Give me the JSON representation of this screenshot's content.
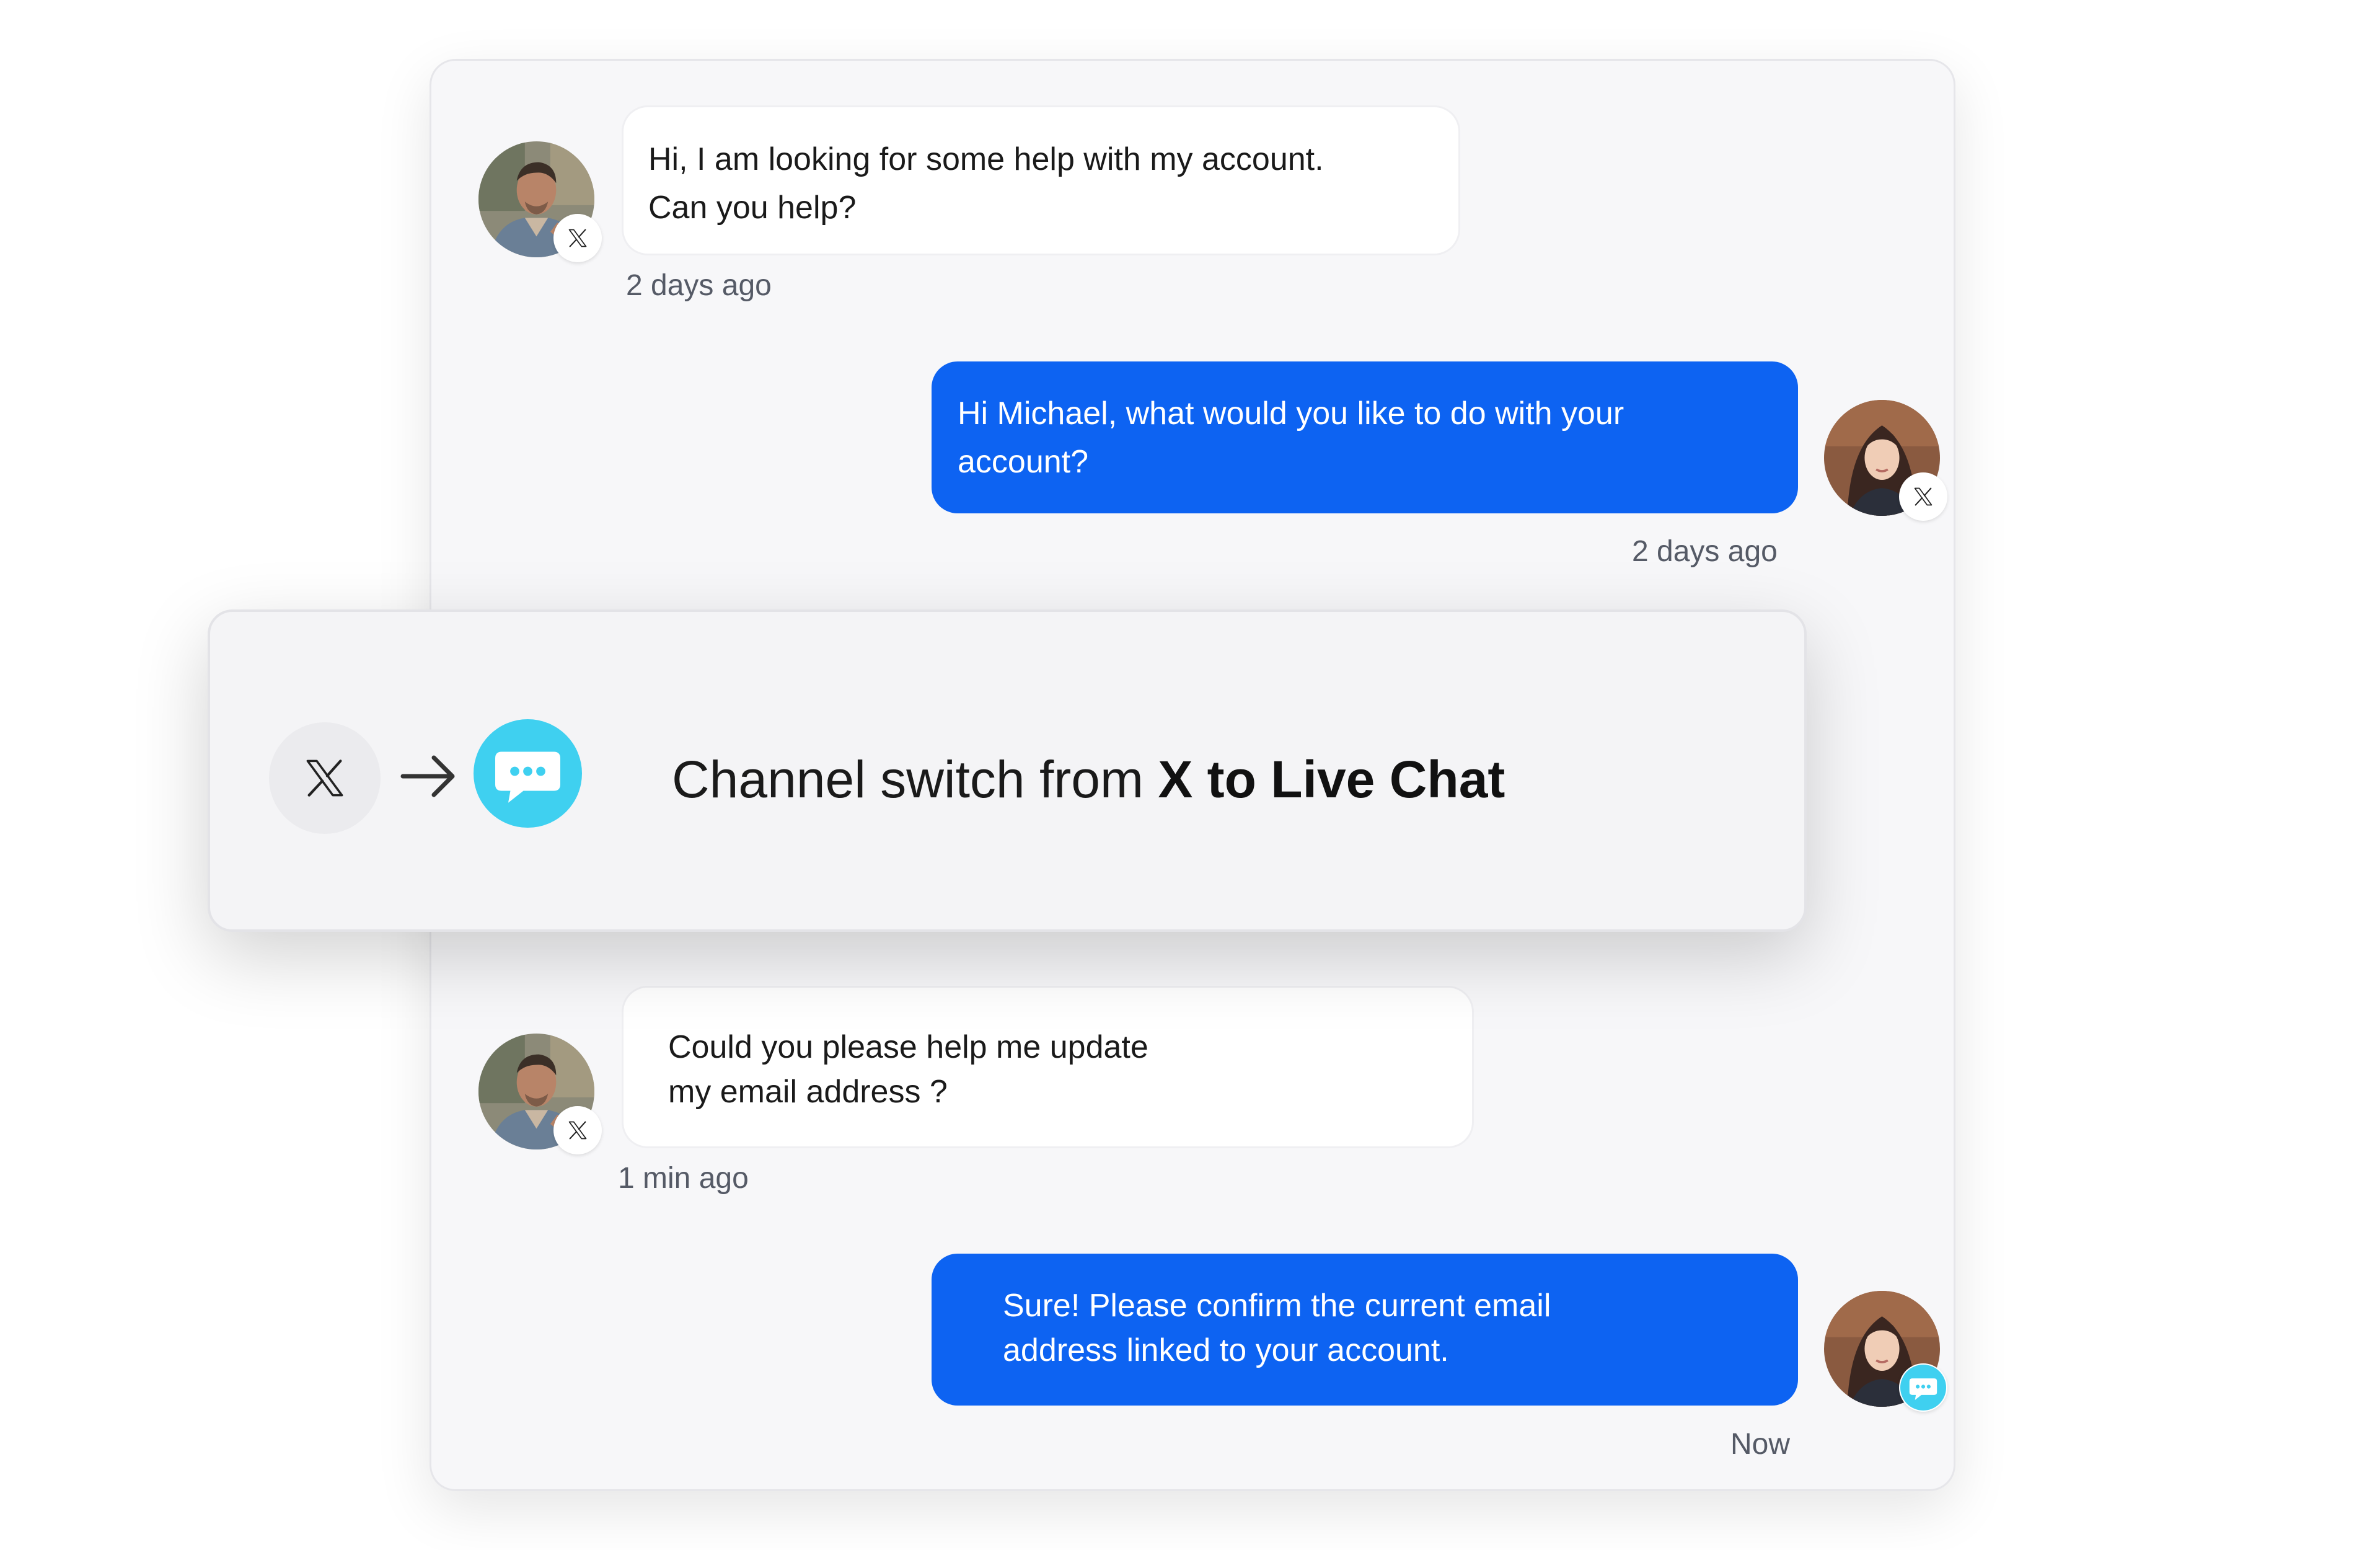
{
  "messages": [
    {
      "direction": "incoming",
      "sender_avatar": "customer-avatar",
      "channel_icon": "x-icon",
      "lines": [
        "Hi, I am looking for some help with my account.",
        "Can you help?"
      ],
      "time": "2 days ago"
    },
    {
      "direction": "outgoing",
      "sender_avatar": "agent-avatar",
      "channel_icon": "x-icon",
      "lines": [
        "Hi Michael, what would you like to do with your",
        "account?"
      ],
      "time": "2 days ago"
    },
    {
      "direction": "incoming",
      "sender_avatar": "customer-avatar",
      "channel_icon": "x-icon",
      "lines": [
        "Could you please help me update",
        "my email address ?"
      ],
      "time": "1 min ago"
    },
    {
      "direction": "outgoing",
      "sender_avatar": "agent-avatar",
      "channel_icon": "live-chat-icon",
      "lines": [
        "Sure! Please confirm the current email",
        "address linked to your account."
      ],
      "time": "Now"
    }
  ],
  "channel_switch": {
    "prefix": "Channel switch from ",
    "emphasis": "X to Live Chat",
    "from_icon": "x-icon",
    "arrow_icon": "arrow-right-icon",
    "to_icon": "live-chat-icon"
  },
  "colors": {
    "outgoing_bubble": "#0d63f2",
    "live_chat": "#3fd0f0",
    "panel_background": "#f7f7f9"
  }
}
